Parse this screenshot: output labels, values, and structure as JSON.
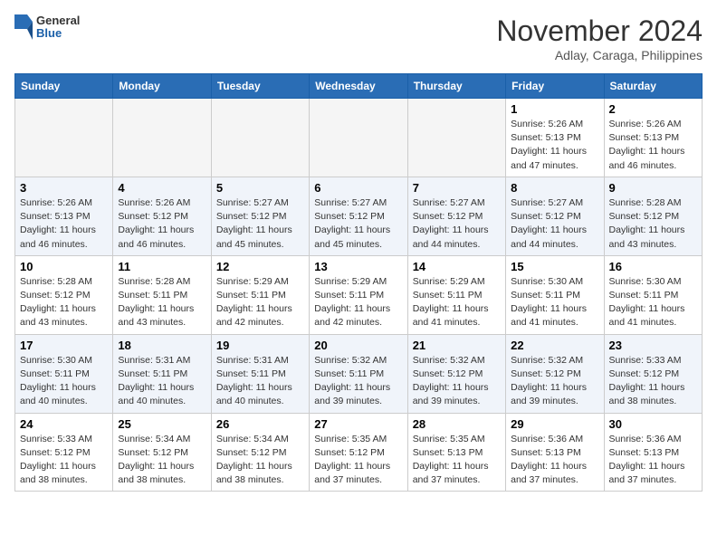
{
  "header": {
    "logo_general": "General",
    "logo_blue": "Blue",
    "month": "November 2024",
    "location": "Adlay, Caraga, Philippines"
  },
  "weekdays": [
    "Sunday",
    "Monday",
    "Tuesday",
    "Wednesday",
    "Thursday",
    "Friday",
    "Saturday"
  ],
  "weeks": [
    [
      {
        "day": "",
        "info": ""
      },
      {
        "day": "",
        "info": ""
      },
      {
        "day": "",
        "info": ""
      },
      {
        "day": "",
        "info": ""
      },
      {
        "day": "",
        "info": ""
      },
      {
        "day": "1",
        "info": "Sunrise: 5:26 AM\nSunset: 5:13 PM\nDaylight: 11 hours\nand 47 minutes."
      },
      {
        "day": "2",
        "info": "Sunrise: 5:26 AM\nSunset: 5:13 PM\nDaylight: 11 hours\nand 46 minutes."
      }
    ],
    [
      {
        "day": "3",
        "info": "Sunrise: 5:26 AM\nSunset: 5:13 PM\nDaylight: 11 hours\nand 46 minutes."
      },
      {
        "day": "4",
        "info": "Sunrise: 5:26 AM\nSunset: 5:12 PM\nDaylight: 11 hours\nand 46 minutes."
      },
      {
        "day": "5",
        "info": "Sunrise: 5:27 AM\nSunset: 5:12 PM\nDaylight: 11 hours\nand 45 minutes."
      },
      {
        "day": "6",
        "info": "Sunrise: 5:27 AM\nSunset: 5:12 PM\nDaylight: 11 hours\nand 45 minutes."
      },
      {
        "day": "7",
        "info": "Sunrise: 5:27 AM\nSunset: 5:12 PM\nDaylight: 11 hours\nand 44 minutes."
      },
      {
        "day": "8",
        "info": "Sunrise: 5:27 AM\nSunset: 5:12 PM\nDaylight: 11 hours\nand 44 minutes."
      },
      {
        "day": "9",
        "info": "Sunrise: 5:28 AM\nSunset: 5:12 PM\nDaylight: 11 hours\nand 43 minutes."
      }
    ],
    [
      {
        "day": "10",
        "info": "Sunrise: 5:28 AM\nSunset: 5:12 PM\nDaylight: 11 hours\nand 43 minutes."
      },
      {
        "day": "11",
        "info": "Sunrise: 5:28 AM\nSunset: 5:11 PM\nDaylight: 11 hours\nand 43 minutes."
      },
      {
        "day": "12",
        "info": "Sunrise: 5:29 AM\nSunset: 5:11 PM\nDaylight: 11 hours\nand 42 minutes."
      },
      {
        "day": "13",
        "info": "Sunrise: 5:29 AM\nSunset: 5:11 PM\nDaylight: 11 hours\nand 42 minutes."
      },
      {
        "day": "14",
        "info": "Sunrise: 5:29 AM\nSunset: 5:11 PM\nDaylight: 11 hours\nand 41 minutes."
      },
      {
        "day": "15",
        "info": "Sunrise: 5:30 AM\nSunset: 5:11 PM\nDaylight: 11 hours\nand 41 minutes."
      },
      {
        "day": "16",
        "info": "Sunrise: 5:30 AM\nSunset: 5:11 PM\nDaylight: 11 hours\nand 41 minutes."
      }
    ],
    [
      {
        "day": "17",
        "info": "Sunrise: 5:30 AM\nSunset: 5:11 PM\nDaylight: 11 hours\nand 40 minutes."
      },
      {
        "day": "18",
        "info": "Sunrise: 5:31 AM\nSunset: 5:11 PM\nDaylight: 11 hours\nand 40 minutes."
      },
      {
        "day": "19",
        "info": "Sunrise: 5:31 AM\nSunset: 5:11 PM\nDaylight: 11 hours\nand 40 minutes."
      },
      {
        "day": "20",
        "info": "Sunrise: 5:32 AM\nSunset: 5:11 PM\nDaylight: 11 hours\nand 39 minutes."
      },
      {
        "day": "21",
        "info": "Sunrise: 5:32 AM\nSunset: 5:12 PM\nDaylight: 11 hours\nand 39 minutes."
      },
      {
        "day": "22",
        "info": "Sunrise: 5:32 AM\nSunset: 5:12 PM\nDaylight: 11 hours\nand 39 minutes."
      },
      {
        "day": "23",
        "info": "Sunrise: 5:33 AM\nSunset: 5:12 PM\nDaylight: 11 hours\nand 38 minutes."
      }
    ],
    [
      {
        "day": "24",
        "info": "Sunrise: 5:33 AM\nSunset: 5:12 PM\nDaylight: 11 hours\nand 38 minutes."
      },
      {
        "day": "25",
        "info": "Sunrise: 5:34 AM\nSunset: 5:12 PM\nDaylight: 11 hours\nand 38 minutes."
      },
      {
        "day": "26",
        "info": "Sunrise: 5:34 AM\nSunset: 5:12 PM\nDaylight: 11 hours\nand 38 minutes."
      },
      {
        "day": "27",
        "info": "Sunrise: 5:35 AM\nSunset: 5:12 PM\nDaylight: 11 hours\nand 37 minutes."
      },
      {
        "day": "28",
        "info": "Sunrise: 5:35 AM\nSunset: 5:13 PM\nDaylight: 11 hours\nand 37 minutes."
      },
      {
        "day": "29",
        "info": "Sunrise: 5:36 AM\nSunset: 5:13 PM\nDaylight: 11 hours\nand 37 minutes."
      },
      {
        "day": "30",
        "info": "Sunrise: 5:36 AM\nSunset: 5:13 PM\nDaylight: 11 hours\nand 37 minutes."
      }
    ]
  ]
}
